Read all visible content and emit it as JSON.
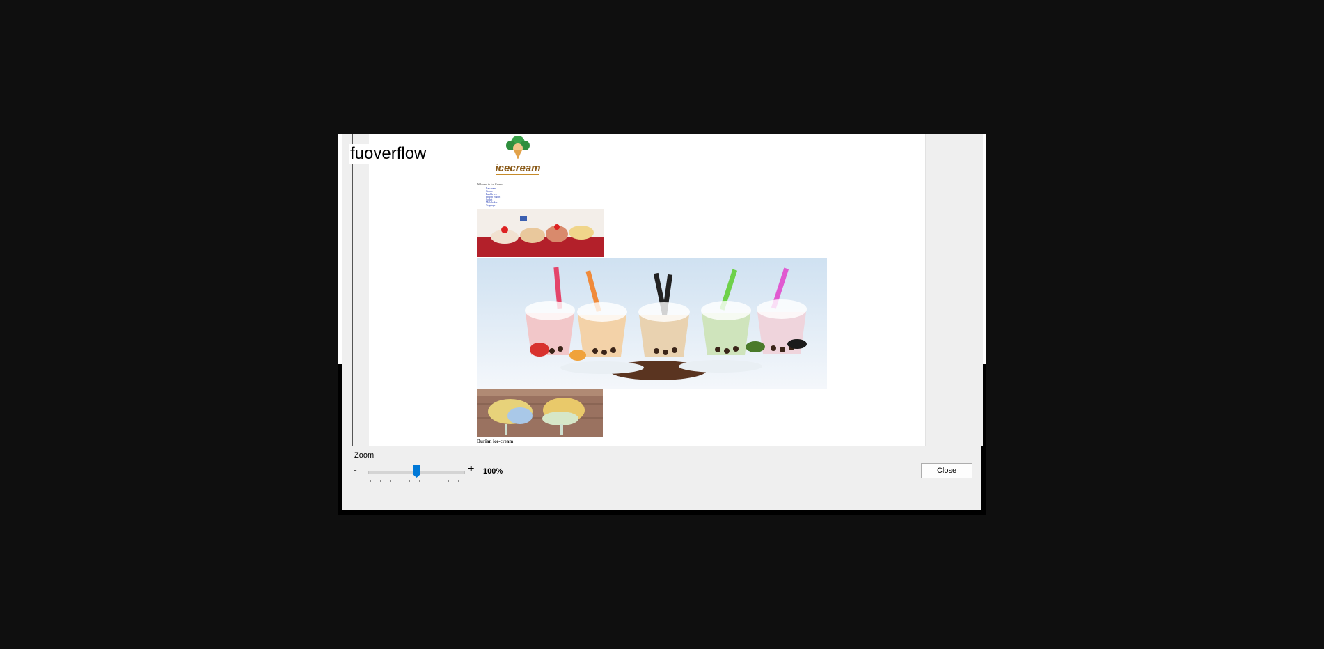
{
  "overlay": {
    "title": "fuoverflow"
  },
  "page_preview": {
    "logo_text": "icecream",
    "welcome_text": "Welcome to Ice Cream",
    "nav_items": [
      "Ice cream",
      "Gelato",
      "Bubble tea",
      "Frozen yogurt",
      "Sorbet",
      "Milkshakes",
      "Toppings"
    ],
    "caption": "Durian ice-cream"
  },
  "zoom": {
    "label": "Zoom",
    "minus": "-",
    "plus": "+",
    "value_text": "100%",
    "level": 100
  },
  "buttons": {
    "close": "Close"
  },
  "colors": {
    "slider_thumb": "#0078d7",
    "page_border": "#7a93c8"
  }
}
